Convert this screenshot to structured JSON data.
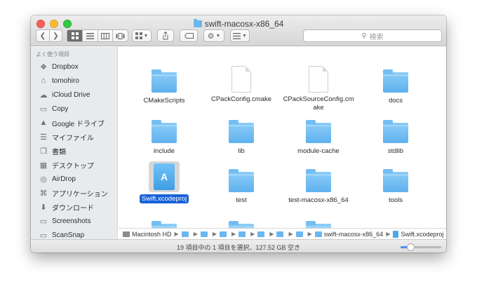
{
  "window": {
    "title": "swift-macosx-x86_64"
  },
  "search": {
    "placeholder": "検索"
  },
  "sidebar": {
    "header": "よく使う項目",
    "items": [
      {
        "label": "Dropbox",
        "icon": "dropbox-icon"
      },
      {
        "label": "tomohiro",
        "icon": "home-icon"
      },
      {
        "label": "iCloud Drive",
        "icon": "cloud-icon"
      },
      {
        "label": "Copy",
        "icon": "folder-icon"
      },
      {
        "label": "Google ドライブ",
        "icon": "google-drive-icon"
      },
      {
        "label": "マイファイル",
        "icon": "all-files-icon"
      },
      {
        "label": "書類",
        "icon": "documents-icon"
      },
      {
        "label": "デスクトップ",
        "icon": "desktop-icon"
      },
      {
        "label": "AirDrop",
        "icon": "airdrop-icon"
      },
      {
        "label": "アプリケーション",
        "icon": "applications-icon"
      },
      {
        "label": "ダウンロード",
        "icon": "downloads-icon"
      },
      {
        "label": "Screenshots",
        "icon": "folder-icon"
      },
      {
        "label": "ScanSnap",
        "icon": "folder-icon"
      }
    ]
  },
  "files": [
    {
      "name": "CMakeScripts",
      "kind": "folder"
    },
    {
      "name": "CPackConfig.cmake",
      "kind": "document"
    },
    {
      "name": "CPackSourceConfig.cmake",
      "kind": "document"
    },
    {
      "name": "docs",
      "kind": "folder"
    },
    {
      "name": "include",
      "kind": "folder"
    },
    {
      "name": "lib",
      "kind": "folder"
    },
    {
      "name": "module-cache",
      "kind": "folder"
    },
    {
      "name": "stdlib",
      "kind": "folder"
    },
    {
      "name": "Swift.xcodeproj",
      "kind": "xcodeproj",
      "selected": true
    },
    {
      "name": "test",
      "kind": "folder"
    },
    {
      "name": "test-macosx-x86_64",
      "kind": "folder"
    },
    {
      "name": "tools",
      "kind": "folder"
    },
    {
      "name": "",
      "kind": "folder"
    },
    {
      "name": "",
      "kind": "folder"
    },
    {
      "name": "",
      "kind": "folder"
    }
  ],
  "pathbar": {
    "root": "Macintosh HD",
    "current_folder": "swift-macosx-x86_64",
    "selected_item": "Swift.xcodeproj"
  },
  "status": {
    "text": "19 項目中の 1 項目を選択、127.52 GB 空き"
  },
  "zoom": {
    "level": 0.15
  },
  "colors": {
    "accent": "#1761d8",
    "folder": "#6cb7ef"
  }
}
